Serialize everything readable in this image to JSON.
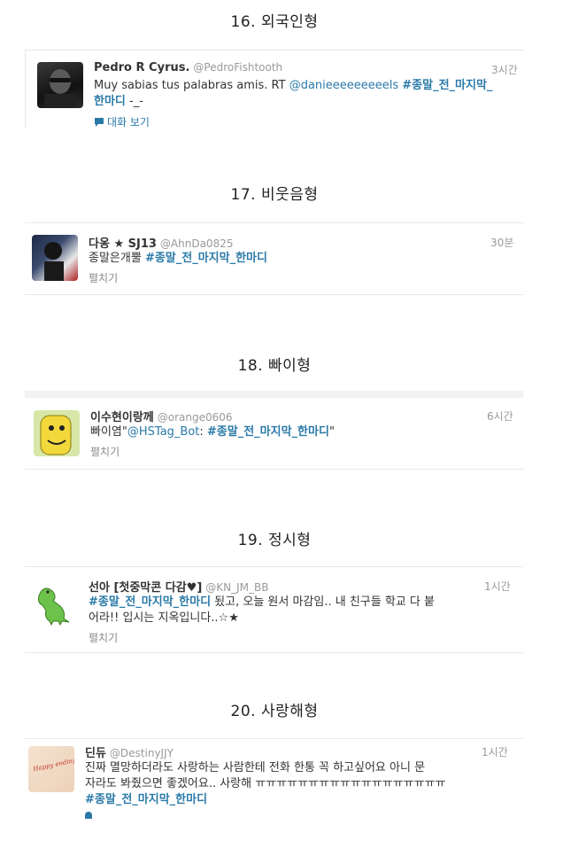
{
  "sections": [
    {
      "title": "16. 외국인형",
      "tweet": {
        "name": "Pedro R Cyrus.",
        "handle": "@PedroFishtooth",
        "time": "3시간",
        "text_plain": "Muy sabias tus palabras amis. RT ",
        "mention": "@danieeeeeeeeels",
        "hashtag": "#종말_전_마지막_",
        "line2_hash": "한마디",
        "line2_rest": " -_-",
        "action": "대화 보기",
        "action_icon": "speech-bubble-icon"
      }
    },
    {
      "title": "17. 비웃음형",
      "tweet": {
        "name": "다옹 ★ SJ13",
        "handle": "@AhnDa0825",
        "time": "30분",
        "text_plain": "종말은개뿔 ",
        "hashtag": "#종말_전_마지막_한마디",
        "action": "펼치기"
      }
    },
    {
      "title": "18. 빠이형",
      "tweet": {
        "name": "이수현이랑께",
        "handle": "@orange0606",
        "time": "6시간",
        "text_plain": "빠이염\"",
        "mention": "@HSTag_Bot",
        "colon": ": ",
        "hashtag": "#종말_전_마지막_한마디",
        "text_end": "\"",
        "action": "펼치기"
      }
    },
    {
      "title": "19. 정시형",
      "tweet": {
        "name": "선아 [첫중막콘 다감♥]",
        "handle": "@KN_JM_BB",
        "time": "1시간",
        "hashtag": "#종말_전_마지막_한마디",
        "text_rest": " 됬고, 오늘 원서 마감임.. 내 친구들 학교 다 붙",
        "line2": "어라!! 입시는 지옥입니다..☆★",
        "action": "펼치기"
      }
    },
    {
      "title": "20. 사랑해형",
      "tweet": {
        "name": "딘듀",
        "handle": "@DestinyJJY",
        "time": "1시간",
        "line1": "진짜 멸망하더라도 사랑하는 사람한테 전화 한통 꼭 하고싶어요 아니 문",
        "line2": "자라도 봐줬으면 좋겠어요.. 사랑해 ㅠㅠㅠㅠㅠㅠㅠㅠㅠㅠㅠㅠㅠㅠㅠㅠㅠㅠ",
        "hashtag": "#종말_전_마지막_한마디",
        "avatar_text": "Happy ending is made"
      }
    }
  ]
}
